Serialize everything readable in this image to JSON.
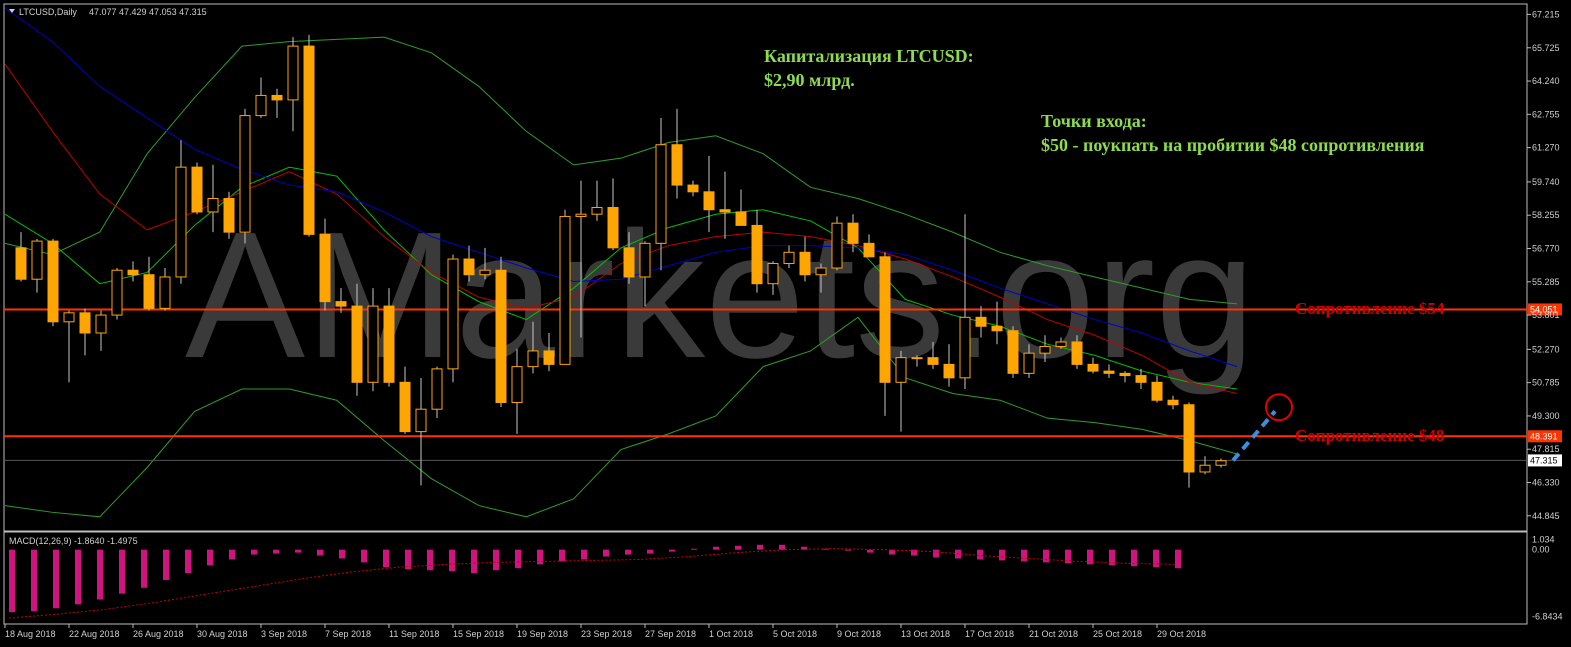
{
  "header": {
    "symbol": "LTCUSD,Daily",
    "ohlc": "47.077 47.429 47.053 47.315"
  },
  "watermark": "AMarkets.org",
  "annotations": {
    "cap_line1": "Капитализация LTCUSD:",
    "cap_line2": "$2,90 млрд.",
    "entry_line1": "Точки входа:",
    "entry_line2": "$50 - поукпать на пробитии $48 сопротивления",
    "res54": "Сопротивление $54",
    "res48": "Сопротивление $48"
  },
  "colors": {
    "bull": "#ffa500",
    "bear": "#ffa500",
    "wick": "#c8c8c8",
    "bollinger": "#2e9d2e",
    "ma_fast": "#00c000",
    "ma_mid": "#c00000",
    "ma_slow": "#0000c8",
    "resistance": "#ff3300",
    "annotation_green": "#8edc4e",
    "annotation_red": "#d10000",
    "macd_hist": "#d0147f",
    "macd_signal": "#cc0000",
    "projection": "#3a8fe0"
  },
  "chart_data": {
    "type": "candlestick",
    "symbol": "LTCUSD",
    "timeframe": "Daily",
    "ylim": [
      44.3,
      67.5
    ],
    "y_ticks": [
      "67.215",
      "65.725",
      "64.240",
      "62.755",
      "61.270",
      "59.740",
      "58.255",
      "56.770",
      "55.285",
      "53.801",
      "52.270",
      "50.785",
      "49.300",
      "47.815",
      "46.330",
      "44.845"
    ],
    "x_labels": [
      "18 Aug 2018",
      "22 Aug 2018",
      "26 Aug 2018",
      "30 Aug 2018",
      "3 Sep 2018",
      "7 Sep 2018",
      "11 Sep 2018",
      "15 Sep 2018",
      "19 Sep 2018",
      "23 Sep 2018",
      "27 Sep 2018",
      "1 Oct 2018",
      "5 Oct 2018",
      "9 Oct 2018",
      "13 Oct 2018",
      "17 Oct 2018",
      "21 Oct 2018",
      "25 Oct 2018",
      "29 Oct 2018"
    ],
    "resistance_levels": [
      {
        "label": "54.051",
        "value": 54.051
      },
      {
        "label": "48.391",
        "value": 48.391
      }
    ],
    "current_price": {
      "label": "47.315",
      "value": 47.315
    },
    "projection_target": 49.6,
    "candles": [
      {
        "o": 56.8,
        "h": 57.5,
        "l": 55.3,
        "c": 55.4
      },
      {
        "o": 55.4,
        "h": 57.2,
        "l": 54.8,
        "c": 57.1
      },
      {
        "o": 57.1,
        "h": 57.2,
        "l": 53.3,
        "c": 53.5
      },
      {
        "o": 53.5,
        "h": 54.0,
        "l": 50.8,
        "c": 53.9
      },
      {
        "o": 53.9,
        "h": 54.1,
        "l": 52.0,
        "c": 53.0
      },
      {
        "o": 53.0,
        "h": 54.0,
        "l": 52.2,
        "c": 53.8
      },
      {
        "o": 53.8,
        "h": 55.9,
        "l": 53.6,
        "c": 55.8
      },
      {
        "o": 55.8,
        "h": 56.2,
        "l": 55.3,
        "c": 55.6
      },
      {
        "o": 55.6,
        "h": 56.4,
        "l": 54.0,
        "c": 54.1
      },
      {
        "o": 54.1,
        "h": 55.9,
        "l": 54.0,
        "c": 55.5
      },
      {
        "o": 55.5,
        "h": 61.6,
        "l": 55.2,
        "c": 60.4
      },
      {
        "o": 60.4,
        "h": 60.6,
        "l": 58.3,
        "c": 58.4
      },
      {
        "o": 58.4,
        "h": 60.5,
        "l": 57.5,
        "c": 59.0
      },
      {
        "o": 59.0,
        "h": 59.3,
        "l": 57.2,
        "c": 57.5
      },
      {
        "o": 57.5,
        "h": 63.0,
        "l": 57.0,
        "c": 62.7
      },
      {
        "o": 62.7,
        "h": 64.4,
        "l": 62.6,
        "c": 63.6
      },
      {
        "o": 63.6,
        "h": 63.9,
        "l": 62.6,
        "c": 63.4
      },
      {
        "o": 63.4,
        "h": 66.2,
        "l": 62.0,
        "c": 65.8
      },
      {
        "o": 65.8,
        "h": 66.3,
        "l": 57.3,
        "c": 57.4
      },
      {
        "o": 57.4,
        "h": 58.1,
        "l": 54.0,
        "c": 54.4
      },
      {
        "o": 54.4,
        "h": 55.0,
        "l": 53.9,
        "c": 54.2
      },
      {
        "o": 54.2,
        "h": 55.2,
        "l": 50.2,
        "c": 50.8
      },
      {
        "o": 50.8,
        "h": 55.0,
        "l": 50.4,
        "c": 54.2
      },
      {
        "o": 54.2,
        "h": 55.0,
        "l": 50.6,
        "c": 50.8
      },
      {
        "o": 50.8,
        "h": 51.5,
        "l": 48.5,
        "c": 48.6
      },
      {
        "o": 48.6,
        "h": 51.0,
        "l": 46.2,
        "c": 49.6
      },
      {
        "o": 49.6,
        "h": 51.5,
        "l": 49.2,
        "c": 51.4
      },
      {
        "o": 51.4,
        "h": 56.5,
        "l": 50.8,
        "c": 56.3
      },
      {
        "o": 56.3,
        "h": 56.9,
        "l": 55.3,
        "c": 55.6
      },
      {
        "o": 55.6,
        "h": 56.8,
        "l": 55.4,
        "c": 55.8
      },
      {
        "o": 55.8,
        "h": 56.4,
        "l": 49.7,
        "c": 49.9
      },
      {
        "o": 49.9,
        "h": 52.3,
        "l": 48.5,
        "c": 51.5
      },
      {
        "o": 51.5,
        "h": 53.5,
        "l": 51.2,
        "c": 52.2
      },
      {
        "o": 52.2,
        "h": 53.0,
        "l": 51.3,
        "c": 51.6
      },
      {
        "o": 51.6,
        "h": 58.5,
        "l": 51.6,
        "c": 58.2
      },
      {
        "o": 58.2,
        "h": 59.8,
        "l": 52.8,
        "c": 58.3
      },
      {
        "o": 58.3,
        "h": 59.8,
        "l": 58.0,
        "c": 58.6
      },
      {
        "o": 58.6,
        "h": 59.9,
        "l": 56.7,
        "c": 56.8
      },
      {
        "o": 56.8,
        "h": 57.5,
        "l": 55.2,
        "c": 55.5
      },
      {
        "o": 55.5,
        "h": 57.1,
        "l": 54.2,
        "c": 57.0
      },
      {
        "o": 57.0,
        "h": 62.6,
        "l": 55.8,
        "c": 61.4
      },
      {
        "o": 61.4,
        "h": 63.0,
        "l": 59.0,
        "c": 59.6
      },
      {
        "o": 59.6,
        "h": 59.8,
        "l": 59.1,
        "c": 59.3
      },
      {
        "o": 59.3,
        "h": 60.9,
        "l": 57.5,
        "c": 58.5
      },
      {
        "o": 58.5,
        "h": 60.2,
        "l": 57.2,
        "c": 58.4
      },
      {
        "o": 58.4,
        "h": 59.4,
        "l": 57.8,
        "c": 57.8
      },
      {
        "o": 57.8,
        "h": 58.5,
        "l": 54.8,
        "c": 55.2
      },
      {
        "o": 55.2,
        "h": 56.2,
        "l": 54.7,
        "c": 56.1
      },
      {
        "o": 56.1,
        "h": 56.9,
        "l": 55.9,
        "c": 56.6
      },
      {
        "o": 56.6,
        "h": 57.3,
        "l": 55.3,
        "c": 55.6
      },
      {
        "o": 55.6,
        "h": 56.1,
        "l": 54.8,
        "c": 55.9
      },
      {
        "o": 55.9,
        "h": 58.2,
        "l": 55.8,
        "c": 57.9
      },
      {
        "o": 57.9,
        "h": 58.3,
        "l": 56.6,
        "c": 57.0
      },
      {
        "o": 57.0,
        "h": 57.4,
        "l": 56.4,
        "c": 56.4
      },
      {
        "o": 56.4,
        "h": 56.6,
        "l": 49.3,
        "c": 50.8
      },
      {
        "o": 50.8,
        "h": 52.2,
        "l": 48.6,
        "c": 51.9
      },
      {
        "o": 51.9,
        "h": 52.0,
        "l": 51.5,
        "c": 51.9
      },
      {
        "o": 51.9,
        "h": 52.6,
        "l": 51.4,
        "c": 51.6
      },
      {
        "o": 51.6,
        "h": 52.5,
        "l": 50.6,
        "c": 51.0
      },
      {
        "o": 51.0,
        "h": 58.3,
        "l": 50.5,
        "c": 53.7
      },
      {
        "o": 53.7,
        "h": 54.2,
        "l": 52.8,
        "c": 53.3
      },
      {
        "o": 53.3,
        "h": 54.4,
        "l": 52.5,
        "c": 53.1
      },
      {
        "o": 53.1,
        "h": 53.3,
        "l": 51.0,
        "c": 51.2
      },
      {
        "o": 51.2,
        "h": 52.5,
        "l": 51.0,
        "c": 52.1
      },
      {
        "o": 52.1,
        "h": 52.9,
        "l": 51.7,
        "c": 52.4
      },
      {
        "o": 52.4,
        "h": 52.8,
        "l": 52.3,
        "c": 52.6
      },
      {
        "o": 52.6,
        "h": 52.9,
        "l": 51.4,
        "c": 51.6
      },
      {
        "o": 51.6,
        "h": 51.9,
        "l": 51.2,
        "c": 51.3
      },
      {
        "o": 51.3,
        "h": 51.6,
        "l": 51.0,
        "c": 51.2
      },
      {
        "o": 51.2,
        "h": 51.3,
        "l": 50.8,
        "c": 51.1
      },
      {
        "o": 51.1,
        "h": 51.4,
        "l": 50.5,
        "c": 50.8
      },
      {
        "o": 50.8,
        "h": 51.1,
        "l": 49.9,
        "c": 50.0
      },
      {
        "o": 50.0,
        "h": 50.2,
        "l": 49.6,
        "c": 49.8
      },
      {
        "o": 49.8,
        "h": 49.9,
        "l": 46.1,
        "c": 46.8
      },
      {
        "o": 46.8,
        "h": 47.5,
        "l": 46.7,
        "c": 47.1
      },
      {
        "o": 47.1,
        "h": 47.4,
        "l": 47.0,
        "c": 47.3
      }
    ],
    "indicators": {
      "bollinger_upper": [
        57.0,
        56.5,
        57.5,
        61.0,
        63.5,
        65.8,
        66.0,
        66.1,
        66.2,
        65.5,
        64.0,
        62.0,
        60.5,
        60.8,
        61.5,
        61.8,
        61.0,
        59.5,
        59.0,
        58.3,
        57.5,
        56.6,
        56.0,
        55.5,
        55.0,
        54.5,
        54.3
      ],
      "bollinger_lower": [
        45.3,
        45.0,
        44.8,
        47.0,
        49.5,
        50.5,
        50.5,
        50.0,
        48.2,
        46.5,
        45.3,
        44.8,
        45.6,
        47.8,
        48.5,
        49.3,
        51.5,
        52.2,
        53.7,
        51.0,
        50.3,
        50.0,
        49.2,
        49.0,
        48.7,
        48.2,
        47.6
      ],
      "bollinger_middle": [
        58.3,
        57.0,
        55.2,
        55.7,
        57.8,
        59.5,
        60.4,
        60.0,
        57.6,
        55.6,
        54.4,
        53.6,
        55.0,
        56.8,
        57.7,
        58.3,
        58.5,
        58.0,
        56.8,
        54.5,
        53.8,
        53.3,
        52.5,
        52.0,
        51.3,
        50.8,
        50.5
      ],
      "ma_red": [
        65.0,
        62.0,
        59.2,
        57.6,
        58.4,
        59.3,
        60.2,
        59.2,
        57.3,
        55.7,
        54.6,
        54.1,
        54.6,
        56.1,
        56.9,
        57.3,
        57.5,
        57.3,
        56.9,
        56.3,
        55.5,
        54.6,
        53.6,
        52.9,
        52.0,
        50.8,
        50.3
      ],
      "ma_blue": [
        67.5,
        66.0,
        64.0,
        62.6,
        61.2,
        60.3,
        59.6,
        59.3,
        58.4,
        57.3,
        56.6,
        55.9,
        55.3,
        55.4,
        56.0,
        56.6,
        56.9,
        56.9,
        56.8,
        56.5,
        55.8,
        55.0,
        54.3,
        53.6,
        53.0,
        52.2,
        51.5
      ]
    },
    "macd": {
      "label": "MACD(12,26,9) -1.8640 -1.4975",
      "ylim": [
        -7.2,
        1.4
      ],
      "y_ticks": [
        "1.034",
        "0.00",
        "-6.8434"
      ],
      "histogram": [
        -6.4,
        -6.3,
        -6.0,
        -5.6,
        -5.1,
        -4.5,
        -3.9,
        -3.1,
        -2.4,
        -1.6,
        -1.0,
        -0.5,
        -0.4,
        -0.3,
        -0.6,
        -0.9,
        -1.3,
        -1.8,
        -2.0,
        -2.1,
        -2.2,
        -2.4,
        -2.1,
        -1.9,
        -1.5,
        -1.2,
        -1.0,
        -0.7,
        -0.5,
        -0.4,
        -0.2,
        0.1,
        0.3,
        0.4,
        0.5,
        0.5,
        0.3,
        0.1,
        -0.1,
        -0.3,
        -0.5,
        -0.6,
        -0.8,
        -0.9,
        -1.0,
        -1.1,
        -1.2,
        -1.3,
        -1.4,
        -1.5,
        -1.6,
        -1.7,
        -1.8,
        -1.9
      ],
      "signal": [
        -7.0,
        -6.6,
        -6.1,
        -5.4,
        -4.6,
        -3.8,
        -3.0,
        -2.3,
        -1.8,
        -1.5,
        -1.3,
        -1.2,
        -1.1,
        -1.0,
        -0.7,
        -0.3,
        0.0,
        0.1,
        0.0,
        -0.2,
        -0.6,
        -0.9,
        -1.2,
        -1.4,
        -1.5
      ]
    }
  }
}
